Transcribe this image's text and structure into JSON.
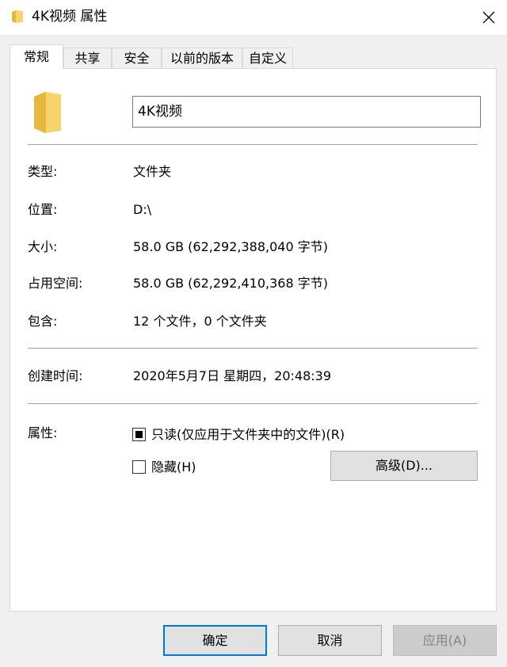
{
  "window": {
    "title": "4K视频 属性"
  },
  "tabs": [
    {
      "label": "常规",
      "active": true
    },
    {
      "label": "共享"
    },
    {
      "label": "安全"
    },
    {
      "label": "以前的版本"
    },
    {
      "label": "自定义"
    }
  ],
  "general": {
    "name": "4K视频",
    "rows": [
      {
        "label": "类型:",
        "value": "文件夹"
      },
      {
        "label": "位置:",
        "value": "D:\\"
      },
      {
        "label": "大小:",
        "value": "58.0 GB (62,292,388,040 字节)"
      },
      {
        "label": "占用空间:",
        "value": "58.0 GB (62,292,410,368 字节)"
      },
      {
        "label": "包含:",
        "value": "12 个文件，0 个文件夹"
      }
    ],
    "created": {
      "label": "创建时间:",
      "value": "2020年5月7日 星期四，20:48:39"
    },
    "attributes": {
      "label": "属性:",
      "readonly": {
        "label": "只读(仅应用于文件夹中的文件)(R)",
        "state": "indeterminate"
      },
      "hidden": {
        "label": "隐藏(H)",
        "checked": false
      },
      "advanced_label": "高级(D)..."
    }
  },
  "buttons": {
    "ok": "确定",
    "cancel": "取消",
    "apply": "应用(A)"
  },
  "colors": {
    "folder": "#f7d36b",
    "folder_dark": "#e8b73d",
    "accent": "#0078d7"
  }
}
